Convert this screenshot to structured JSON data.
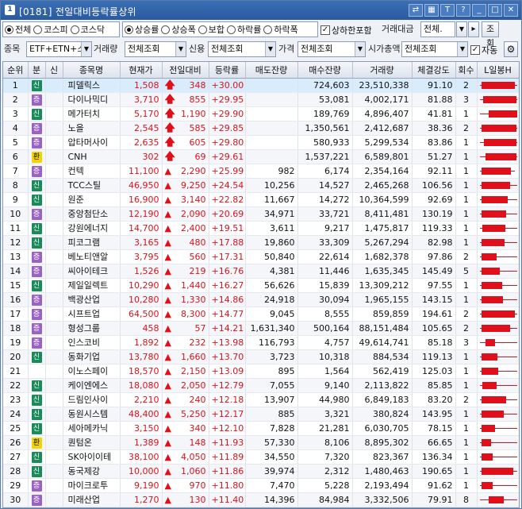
{
  "window": {
    "icon_label": "1",
    "title": "[0181] 전일대비등락률상위",
    "title_buttons": [
      "⇄",
      "▦",
      "T",
      "?",
      "_",
      "□",
      "✕"
    ]
  },
  "toolbar1": {
    "market_options": [
      {
        "label": "전체",
        "selected": true
      },
      {
        "label": "코스피",
        "selected": false
      },
      {
        "label": "코스닥",
        "selected": false
      }
    ],
    "sort_options": [
      {
        "label": "상승률",
        "selected": true
      },
      {
        "label": "상승폭",
        "selected": false
      },
      {
        "label": "보합",
        "selected": false
      },
      {
        "label": "하락률",
        "selected": false
      },
      {
        "label": "하락폭",
        "selected": false
      }
    ],
    "include_upper_limit_label": "상하한포함",
    "include_upper_limit_checked": true,
    "volume_label": "거래대금",
    "volume_value": "전체.",
    "query_button": "조회"
  },
  "toolbar2": {
    "stock_label": "종목",
    "stock_value": "ETF+ETN+스팩",
    "trade_volume_label": "거래량",
    "trade_volume_value": "전체조회",
    "credit_label": "신용",
    "credit_value": "전체조회",
    "price_label": "가격",
    "price_value": "전체조회",
    "market_cap_label": "시가총액",
    "market_cap_value": "전체조회",
    "auto_label": "자동",
    "auto_checked": true
  },
  "columns": [
    "순위",
    "분",
    "신",
    "종목명",
    "현재가",
    "전일대비",
    "등락률",
    "매도잔량",
    "매수잔량",
    "거래량",
    "체결강도",
    "회수",
    "L일봉H"
  ],
  "rows": [
    {
      "rank": "1",
      "tag": "신",
      "tag_color": "green",
      "name": "피델릭스",
      "price": "1,508",
      "arrow": "up-big",
      "diff": "348",
      "rate": "+30.00",
      "ask": "",
      "bid": "724,603",
      "volume": "23,510,338",
      "strength": "91.10",
      "count": "2",
      "bar_low": 0,
      "bar_open": 0.05,
      "bar_close": 0.95,
      "bar_high": 1.0
    },
    {
      "rank": "2",
      "tag": "증",
      "tag_color": "purple",
      "name": "다이나믹디",
      "price": "3,710",
      "arrow": "up-big",
      "diff": "855",
      "rate": "+29.95",
      "ask": "",
      "bid": "53,081",
      "volume": "4,002,171",
      "strength": "81.88",
      "count": "3",
      "bar_low": 0,
      "bar_open": 0.1,
      "bar_close": 1.0,
      "bar_high": 1.0
    },
    {
      "rank": "3",
      "tag": "신",
      "tag_color": "green",
      "name": "메가터치",
      "price": "5,170",
      "arrow": "up-big",
      "diff": "1,190",
      "rate": "+29.90",
      "ask": "",
      "bid": "189,769",
      "volume": "4,896,407",
      "strength": "41.81",
      "count": "1",
      "bar_low": 0,
      "bar_open": 0.25,
      "bar_close": 1.0,
      "bar_high": 1.0
    },
    {
      "rank": "4",
      "tag": "증",
      "tag_color": "purple",
      "name": "노을",
      "price": "2,545",
      "arrow": "up-big",
      "diff": "585",
      "rate": "+29.85",
      "ask": "",
      "bid": "1,350,561",
      "volume": "2,412,687",
      "strength": "38.36",
      "count": "2",
      "bar_low": 0,
      "bar_open": 0.05,
      "bar_close": 1.0,
      "bar_high": 1.0
    },
    {
      "rank": "5",
      "tag": "증",
      "tag_color": "purple",
      "name": "압타머사이",
      "price": "2,635",
      "arrow": "up-big",
      "diff": "605",
      "rate": "+29.80",
      "ask": "",
      "bid": "580,933",
      "volume": "5,299,534",
      "strength": "83.86",
      "count": "1",
      "bar_low": 0,
      "bar_open": 0.12,
      "bar_close": 1.0,
      "bar_high": 1.0
    },
    {
      "rank": "6",
      "tag": "환",
      "tag_color": "yellow",
      "name": "CNH",
      "price": "302",
      "arrow": "up-big",
      "diff": "69",
      "rate": "+29.61",
      "ask": "",
      "bid": "1,537,221",
      "volume": "6,589,801",
      "strength": "51.27",
      "count": "1",
      "bar_low": 0,
      "bar_open": 0.15,
      "bar_close": 1.0,
      "bar_high": 1.0
    },
    {
      "rank": "7",
      "tag": "증",
      "tag_color": "purple",
      "name": "컨텍",
      "price": "11,100",
      "arrow": "up",
      "diff": "2,290",
      "rate": "+25.99",
      "ask": "982",
      "bid": "6,174",
      "volume": "2,354,164",
      "strength": "92.11",
      "count": "1",
      "bar_low": 0.0,
      "bar_open": 0.05,
      "bar_close": 0.85,
      "bar_high": 0.95
    },
    {
      "rank": "8",
      "tag": "신",
      "tag_color": "green",
      "name": "TCC스틸",
      "price": "46,950",
      "arrow": "up",
      "diff": "9,250",
      "rate": "+24.54",
      "ask": "10,256",
      "bid": "14,527",
      "volume": "2,465,268",
      "strength": "106.56",
      "count": "1",
      "bar_low": 0.0,
      "bar_open": 0.05,
      "bar_close": 0.82,
      "bar_high": 1.0
    },
    {
      "rank": "9",
      "tag": "신",
      "tag_color": "green",
      "name": "원준",
      "price": "16,900",
      "arrow": "up",
      "diff": "3,140",
      "rate": "+22.82",
      "ask": "11,667",
      "bid": "14,272",
      "volume": "10,364,599",
      "strength": "92.69",
      "count": "1",
      "bar_low": 0.0,
      "bar_open": 0.05,
      "bar_close": 0.75,
      "bar_high": 1.0
    },
    {
      "rank": "10",
      "tag": "증",
      "tag_color": "purple",
      "name": "중앙첨단소",
      "price": "12,190",
      "arrow": "up",
      "diff": "2,090",
      "rate": "+20.69",
      "ask": "34,971",
      "bid": "33,721",
      "volume": "8,411,481",
      "strength": "130.19",
      "count": "1",
      "bar_low": 0.0,
      "bar_open": 0.05,
      "bar_close": 0.72,
      "bar_high": 1.0
    },
    {
      "rank": "11",
      "tag": "신",
      "tag_color": "green",
      "name": "강원에너지",
      "price": "14,700",
      "arrow": "up",
      "diff": "2,400",
      "rate": "+19.51",
      "ask": "3,611",
      "bid": "9,217",
      "volume": "1,475,817",
      "strength": "119.33",
      "count": "1",
      "bar_low": 0.0,
      "bar_open": 0.08,
      "bar_close": 0.7,
      "bar_high": 1.0
    },
    {
      "rank": "12",
      "tag": "신",
      "tag_color": "green",
      "name": "피코그램",
      "price": "3,165",
      "arrow": "up",
      "diff": "480",
      "rate": "+17.88",
      "ask": "19,860",
      "bid": "33,309",
      "volume": "5,267,294",
      "strength": "82.98",
      "count": "1",
      "bar_low": 0.0,
      "bar_open": 0.05,
      "bar_close": 0.68,
      "bar_high": 1.0
    },
    {
      "rank": "13",
      "tag": "증",
      "tag_color": "purple",
      "name": "베노티앤알",
      "price": "3,795",
      "arrow": "up",
      "diff": "560",
      "rate": "+17.31",
      "ask": "50,840",
      "bid": "22,614",
      "volume": "1,682,378",
      "strength": "97.86",
      "count": "2",
      "bar_low": 0.0,
      "bar_open": 0.05,
      "bar_close": 0.45,
      "bar_high": 1.0
    },
    {
      "rank": "14",
      "tag": "증",
      "tag_color": "purple",
      "name": "씨아이테크",
      "price": "1,526",
      "arrow": "up",
      "diff": "219",
      "rate": "+16.76",
      "ask": "4,381",
      "bid": "11,446",
      "volume": "1,635,345",
      "strength": "145.49",
      "count": "5",
      "bar_low": 0.0,
      "bar_open": 0.05,
      "bar_close": 0.55,
      "bar_high": 1.0
    },
    {
      "rank": "15",
      "tag": "신",
      "tag_color": "green",
      "name": "제일일렉트",
      "price": "10,290",
      "arrow": "up",
      "diff": "1,440",
      "rate": "+16.27",
      "ask": "56,626",
      "bid": "15,839",
      "volume": "13,309,212",
      "strength": "97.55",
      "count": "1",
      "bar_low": 0.0,
      "bar_open": 0.05,
      "bar_close": 0.6,
      "bar_high": 1.0
    },
    {
      "rank": "16",
      "tag": "증",
      "tag_color": "purple",
      "name": "백광산업",
      "price": "10,280",
      "arrow": "up",
      "diff": "1,330",
      "rate": "+14.86",
      "ask": "24,918",
      "bid": "30,094",
      "volume": "1,965,155",
      "strength": "143.15",
      "count": "1",
      "bar_low": 0.0,
      "bar_open": 0.05,
      "bar_close": 0.62,
      "bar_high": 1.0
    },
    {
      "rank": "17",
      "tag": "증",
      "tag_color": "purple",
      "name": "시프트업",
      "price": "64,500",
      "arrow": "up",
      "diff": "8,300",
      "rate": "+14.77",
      "ask": "9,045",
      "bid": "8,555",
      "volume": "859,859",
      "strength": "194.61",
      "count": "2",
      "bar_low": 0.0,
      "bar_open": 0.05,
      "bar_close": 0.95,
      "bar_high": 1.0
    },
    {
      "rank": "18",
      "tag": "증",
      "tag_color": "purple",
      "name": "형성그룹",
      "price": "458",
      "arrow": "up",
      "diff": "57",
      "rate": "+14.21",
      "ask": "1,631,340",
      "bid": "500,164",
      "volume": "88,151,484",
      "strength": "105.65",
      "count": "2",
      "bar_low": 0.0,
      "bar_open": 0.05,
      "bar_close": 0.82,
      "bar_high": 1.0
    },
    {
      "rank": "19",
      "tag": "증",
      "tag_color": "purple",
      "name": "인스코비",
      "price": "1,892",
      "arrow": "up",
      "diff": "232",
      "rate": "+13.98",
      "ask": "116,793",
      "bid": "4,757",
      "volume": "49,614,741",
      "strength": "85.18",
      "count": "3",
      "bar_low": 0.0,
      "bar_open": 0.15,
      "bar_close": 0.42,
      "bar_high": 1.0
    },
    {
      "rank": "20",
      "tag": "신",
      "tag_color": "green",
      "name": "동화기업",
      "price": "13,780",
      "arrow": "up",
      "diff": "1,660",
      "rate": "+13.70",
      "ask": "3,723",
      "bid": "10,318",
      "volume": "884,534",
      "strength": "119.13",
      "count": "1",
      "bar_low": 0.0,
      "bar_open": 0.05,
      "bar_close": 0.48,
      "bar_high": 1.0
    },
    {
      "rank": "21",
      "tag": "",
      "tag_color": "",
      "name": "이노스페이",
      "price": "18,570",
      "arrow": "up",
      "diff": "2,150",
      "rate": "+13.09",
      "ask": "895",
      "bid": "1,564",
      "volume": "562,419",
      "strength": "125.03",
      "count": "1",
      "bar_low": 0.0,
      "bar_open": 0.05,
      "bar_close": 0.5,
      "bar_high": 1.0
    },
    {
      "rank": "22",
      "tag": "신",
      "tag_color": "green",
      "name": "케이엔에스",
      "price": "18,080",
      "arrow": "up",
      "diff": "2,050",
      "rate": "+12.79",
      "ask": "7,055",
      "bid": "9,140",
      "volume": "2,113,822",
      "strength": "85.85",
      "count": "1",
      "bar_low": 0.0,
      "bar_open": 0.08,
      "bar_close": 0.45,
      "bar_high": 1.0
    },
    {
      "rank": "23",
      "tag": "신",
      "tag_color": "green",
      "name": "드림인사이",
      "price": "2,210",
      "arrow": "up",
      "diff": "240",
      "rate": "+12.18",
      "ask": "13,907",
      "bid": "44,980",
      "volume": "6,849,183",
      "strength": "83.20",
      "count": "2",
      "bar_low": 0.0,
      "bar_open": 0.05,
      "bar_close": 0.72,
      "bar_high": 1.0
    },
    {
      "rank": "24",
      "tag": "신",
      "tag_color": "green",
      "name": "동원시스템",
      "price": "48,400",
      "arrow": "up",
      "diff": "5,250",
      "rate": "+12.17",
      "ask": "885",
      "bid": "3,321",
      "volume": "380,824",
      "strength": "143.95",
      "count": "1",
      "bar_low": 0.0,
      "bar_open": 0.05,
      "bar_close": 0.65,
      "bar_high": 1.0
    },
    {
      "rank": "25",
      "tag": "신",
      "tag_color": "green",
      "name": "세아메카닉",
      "price": "3,150",
      "arrow": "up",
      "diff": "340",
      "rate": "+12.10",
      "ask": "7,828",
      "bid": "21,281",
      "volume": "6,030,705",
      "strength": "78.15",
      "count": "1",
      "bar_low": 0.0,
      "bar_open": 0.05,
      "bar_close": 0.42,
      "bar_high": 1.0
    },
    {
      "rank": "26",
      "tag": "환",
      "tag_color": "yellow",
      "name": "퀀텀온",
      "price": "1,389",
      "arrow": "up",
      "diff": "148",
      "rate": "+11.93",
      "ask": "57,330",
      "bid": "8,106",
      "volume": "8,895,302",
      "strength": "66.65",
      "count": "1",
      "bar_low": 0.0,
      "bar_open": 0.05,
      "bar_close": 0.3,
      "bar_high": 1.0
    },
    {
      "rank": "27",
      "tag": "신",
      "tag_color": "green",
      "name": "SK아이이테",
      "price": "38,100",
      "arrow": "up",
      "diff": "4,050",
      "rate": "+11.89",
      "ask": "34,550",
      "bid": "7,320",
      "volume": "823,367",
      "strength": "136.34",
      "count": "1",
      "bar_low": 0.0,
      "bar_open": 0.05,
      "bar_close": 0.35,
      "bar_high": 1.0
    },
    {
      "rank": "28",
      "tag": "신",
      "tag_color": "green",
      "name": "동국제강",
      "price": "10,000",
      "arrow": "up",
      "diff": "1,060",
      "rate": "+11.86",
      "ask": "39,974",
      "bid": "2,312",
      "volume": "1,480,463",
      "strength": "190.65",
      "count": "1",
      "bar_low": 0.0,
      "bar_open": 0.05,
      "bar_close": 0.9,
      "bar_high": 1.0
    },
    {
      "rank": "29",
      "tag": "증",
      "tag_color": "purple",
      "name": "마이크로투",
      "price": "9,190",
      "arrow": "up",
      "diff": "970",
      "rate": "+11.80",
      "ask": "7,470",
      "bid": "5,228",
      "volume": "2,193,494",
      "strength": "91.62",
      "count": "1",
      "bar_low": 0.0,
      "bar_open": 0.05,
      "bar_close": 0.35,
      "bar_high": 1.0
    },
    {
      "rank": "30",
      "tag": "증",
      "tag_color": "purple",
      "name": "미래산업",
      "price": "1,270",
      "arrow": "up",
      "diff": "130",
      "rate": "+11.40",
      "ask": "14,396",
      "bid": "84,984",
      "volume": "3,332,506",
      "strength": "79.91",
      "count": "8",
      "bar_low": 0.0,
      "bar_open": 0.25,
      "bar_close": 0.65,
      "bar_high": 1.0
    }
  ]
}
